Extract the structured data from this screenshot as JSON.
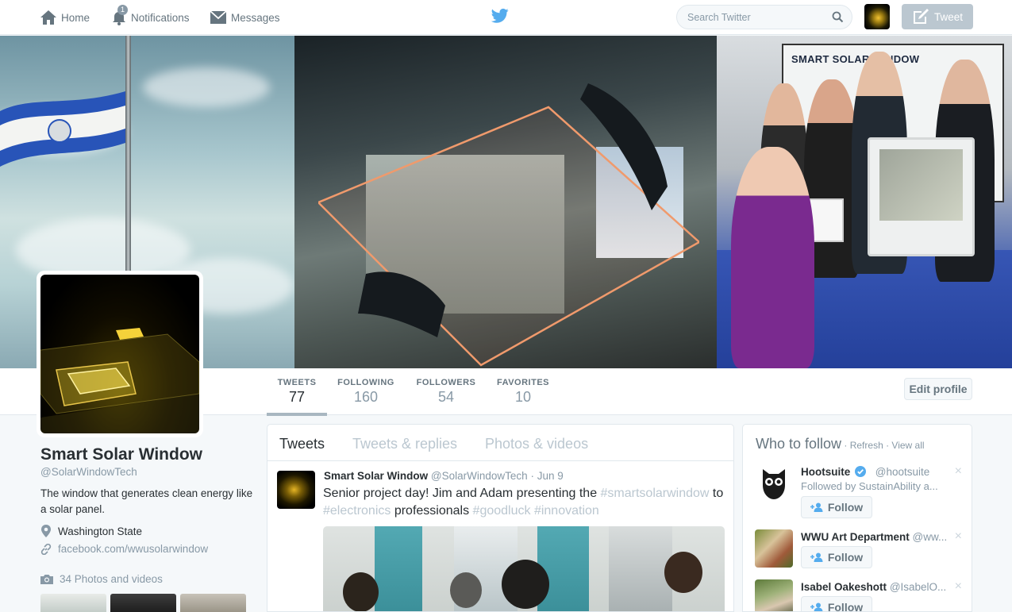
{
  "nav": {
    "home_label": "Home",
    "notifications_label": "Notifications",
    "notifications_count": "1",
    "messages_label": "Messages",
    "search_placeholder": "Search Twitter",
    "tweet_button_label": "Tweet"
  },
  "banner": {
    "poster_title": "SMART SOLAR WINDOW"
  },
  "profile": {
    "name": "Smart Solar Window",
    "handle": "@SolarWindowTech",
    "bio": "The window that generates clean energy like a solar panel.",
    "location": "Washington State",
    "link": "facebook.com/wwusolarwindow",
    "photos_label": "34 Photos and videos",
    "edit_button_label": "Edit profile"
  },
  "stats": [
    {
      "label": "TWEETS",
      "value": "77",
      "active": true
    },
    {
      "label": "FOLLOWING",
      "value": "160",
      "active": false
    },
    {
      "label": "FOLLOWERS",
      "value": "54",
      "active": false
    },
    {
      "label": "FAVORITES",
      "value": "10",
      "active": false
    }
  ],
  "timeline": {
    "tabs": [
      {
        "label": "Tweets",
        "active": true
      },
      {
        "label": "Tweets & replies",
        "active": false
      },
      {
        "label": "Photos & videos",
        "active": false
      }
    ],
    "tweet": {
      "name": "Smart Solar Window",
      "handle": "@SolarWindowTech",
      "dot": "·",
      "time": "Jun 9",
      "text_1": "Senior project day! Jim and Adam presenting the ",
      "hashtag_1": "#smartsolarwindow",
      "text_2": " to ",
      "hashtag_2": "#electronics",
      "text_3": " professionals ",
      "hashtag_3": "#goodluck",
      "text_4": " ",
      "hashtag_4": "#innovation"
    }
  },
  "who_to_follow": {
    "title": "Who to follow",
    "sep": " · ",
    "refresh": "Refresh",
    "view_all": "View all",
    "follow_label": "Follow",
    "close_glyph": "×",
    "suggestions": [
      {
        "name": "Hootsuite",
        "handle": "@hootsuite",
        "verified": true,
        "followed_by": "Followed by SustainAbility a..."
      },
      {
        "name": "WWU Art Department",
        "handle": "@ww...",
        "verified": false,
        "followed_by": ""
      },
      {
        "name": "Isabel Oakeshott",
        "handle": "@IsabelO...",
        "verified": false,
        "followed_by": ""
      }
    ]
  },
  "colors": {
    "twitter_blue": "#55acee",
    "hashtag_gray": "#bbc7d0",
    "verified_blue": "#55acee"
  },
  "icons": [
    "home-icon",
    "bell-icon",
    "envelope-icon",
    "twitter-bird-icon",
    "search-icon",
    "compose-icon",
    "location-pin-icon",
    "link-icon",
    "camera-icon",
    "verified-badge-icon",
    "add-user-icon",
    "close-icon"
  ]
}
